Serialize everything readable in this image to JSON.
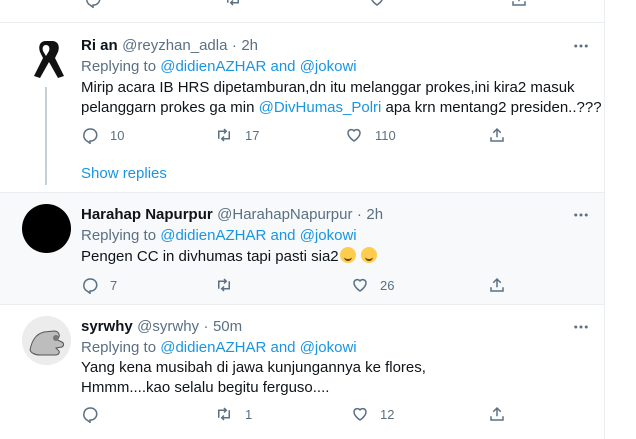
{
  "tweets": [
    {
      "name": "Ri an",
      "handle": "@reyzhan_adla",
      "dot": "·",
      "time": "2h",
      "replying_prefix": "Replying to ",
      "replying_user1": "@didienAZHAR",
      "replying_and": " and ",
      "replying_user2": "@jokowi",
      "line1": "Mirip acara IB HRS dipetamburan,dn itu melanggar prokes,ini kira2 masuk",
      "line2_pre": "pelanggarn prokes ga min ",
      "line2_mention": "@DivHumas_Polri",
      "line2_post": " apa krn mentang2 presiden..???",
      "replies": "10",
      "retweets": "17",
      "likes": "110",
      "show_replies": "Show replies"
    },
    {
      "name": "Harahap Napurpur",
      "handle": "@HarahapNapurpur",
      "dot": "·",
      "time": "2h",
      "replying_prefix": "Replying to ",
      "replying_user1": "@didienAZHAR",
      "replying_and": " and ",
      "replying_user2": "@jokowi",
      "line1": "Pengen CC in divhumas tapi pasti sia2",
      "replies": "7",
      "retweets": "",
      "likes": "26"
    },
    {
      "name": "syrwhy",
      "handle": "@syrwhy",
      "dot": "·",
      "time": "50m",
      "replying_prefix": "Replying to ",
      "replying_user1": "@didienAZHAR",
      "replying_and": " and ",
      "replying_user2": "@jokowi",
      "line1": "Yang kena musibah di jawa kunjungannya ke flores,",
      "line2": "Hmmm....kao selalu begitu ferguso....",
      "replies": "",
      "retweets": "1",
      "likes": "12"
    }
  ],
  "colors": {
    "link": "#1b95e0",
    "muted": "#5b7083",
    "border": "#ebeef0"
  }
}
